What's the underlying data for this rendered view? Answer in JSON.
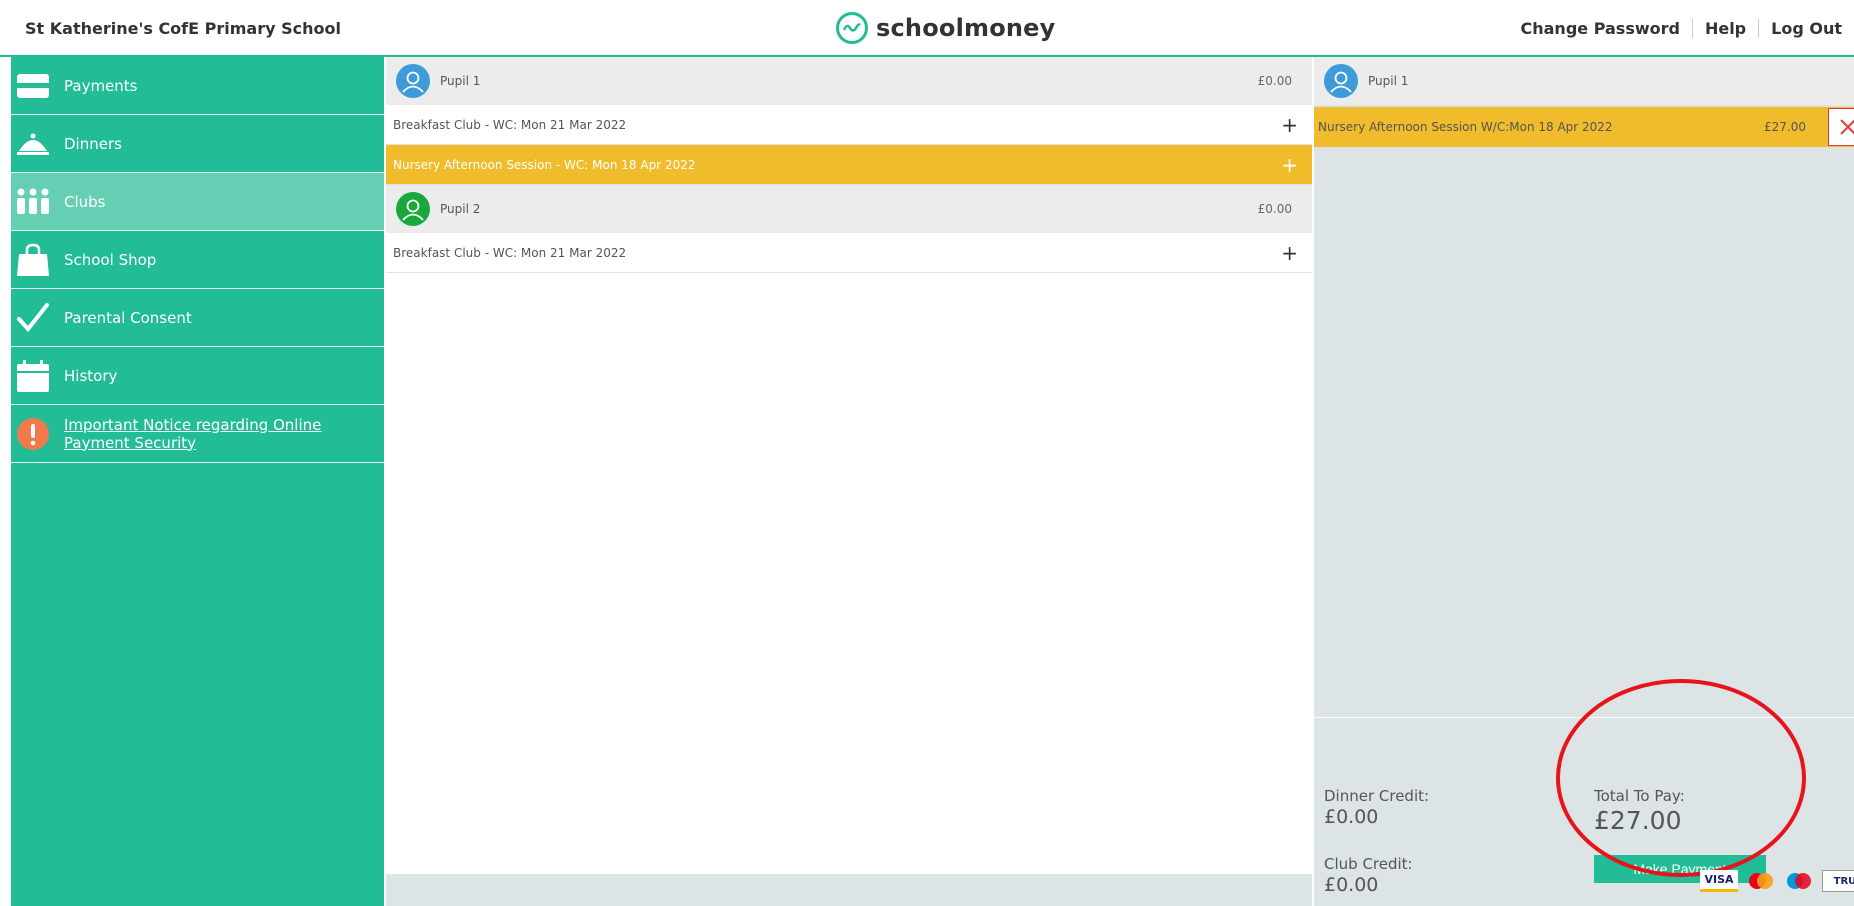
{
  "header": {
    "school_name": "St Katherine's CofE Primary School",
    "logo_text": "schoolmoney",
    "links": [
      "Change Password",
      "Help",
      "Log Out"
    ]
  },
  "sidebar": {
    "items": [
      {
        "label": "Payments",
        "icon": "card-icon"
      },
      {
        "label": "Dinners",
        "icon": "cloche-icon"
      },
      {
        "label": "Clubs",
        "icon": "people-icon",
        "active": true
      },
      {
        "label": "School Shop",
        "icon": "shopping-bag-icon"
      },
      {
        "label": "Parental Consent",
        "icon": "checkmark-icon"
      },
      {
        "label": "History",
        "icon": "calendar-icon"
      },
      {
        "label": "Important Notice regarding Online Payment Security",
        "icon": "exclamation-icon"
      }
    ]
  },
  "middle": {
    "pupils": [
      {
        "name": "Pupil 1",
        "amount": "£0.00",
        "avatar_color": "#3d9bd9",
        "clubs": [
          {
            "label": "Breakfast Club - WC: Mon 21 Mar 2022",
            "selected": false
          },
          {
            "label": "Nursery Afternoon Session - WC: Mon 18 Apr 2022",
            "selected": true
          }
        ]
      },
      {
        "name": "Pupil 2",
        "amount": "£0.00",
        "avatar_color": "#1aa83c",
        "clubs": [
          {
            "label": "Breakfast Club - WC: Mon 21 Mar 2022",
            "selected": false
          }
        ]
      }
    ],
    "add_symbol": "+"
  },
  "basket": {
    "pupil": {
      "name": "Pupil 1",
      "avatar_color": "#3d9bd9"
    },
    "items": [
      {
        "label": "Nursery Afternoon Session W/C:Mon 18 Apr 2022",
        "price": "£27.00"
      }
    ],
    "dinner_credit_label": "Dinner Credit:",
    "dinner_credit_value": "£0.00",
    "club_credit_label": "Club Credit:",
    "club_credit_value": "£0.00",
    "total_label": "Total To Pay:",
    "total_value": "£27.00",
    "pay_button": "Make Payment",
    "payment_cards": [
      "VISA",
      "Mastercard",
      "Maestro",
      "TRUST"
    ]
  },
  "colors": {
    "brand_green": "#22bc96",
    "active_nav": "#66cfb3",
    "selected_yellow": "#f0bc2c",
    "annotation_red": "#e8141c"
  }
}
